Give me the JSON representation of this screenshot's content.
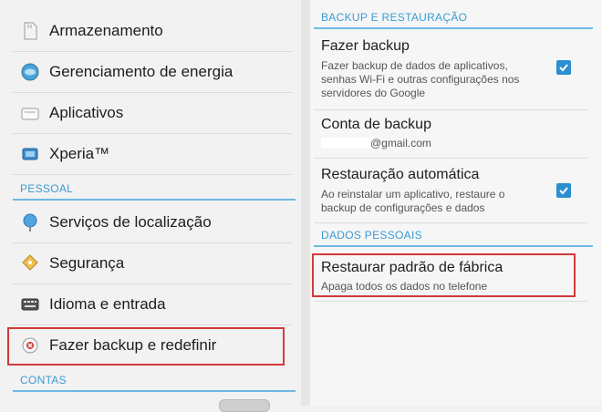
{
  "left_pane": {
    "items_top": [
      {
        "label": "Armazenamento",
        "icon": "sd-card-icon"
      },
      {
        "label": "Gerenciamento de energia",
        "icon": "battery-icon"
      },
      {
        "label": "Aplicativos",
        "icon": "apps-icon"
      },
      {
        "label": "Xperia™",
        "icon": "xperia-icon"
      }
    ],
    "section_pessoal": "PESSOAL",
    "items_pessoal": [
      {
        "label": "Serviços de localização",
        "icon": "location-icon"
      },
      {
        "label": "Segurança",
        "icon": "lock-key-icon"
      },
      {
        "label": "Idioma e entrada",
        "icon": "keyboard-icon"
      },
      {
        "label": "Fazer backup e redefinir",
        "icon": "backup-reset-icon"
      }
    ],
    "section_contas": "CONTAS"
  },
  "right_pane": {
    "section_backup": "BACKUP E RESTAURAÇÃO",
    "fazer_backup": {
      "title": "Fazer backup",
      "subtitle": "Fazer backup de dados de aplicativos, senhas Wi-Fi e outras configurações nos servidores do Google",
      "checked": true
    },
    "conta_backup": {
      "title": "Conta de backup",
      "email_suffix": "@gmail.com"
    },
    "restauracao": {
      "title": "Restauração automática",
      "subtitle": "Ao reinstalar um aplicativo, restaure o backup de configurações e dados",
      "checked": true
    },
    "section_dados": "DADOS PESSOAIS",
    "restaurar": {
      "title": "Restaurar padrão de fábrica",
      "subtitle": "Apaga todos os dados no telefone"
    }
  },
  "colors": {
    "accent": "#3a9bd3",
    "highlight_box": "#d23a3a",
    "checkbox": "#2b8fd0"
  }
}
